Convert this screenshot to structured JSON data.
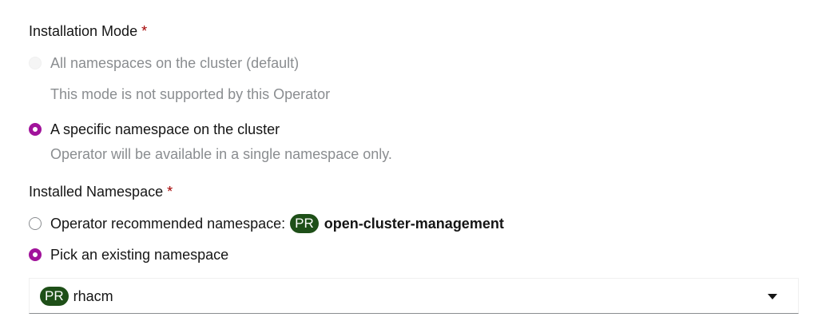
{
  "installation_mode": {
    "label": "Installation Mode",
    "required_marker": "*",
    "options": [
      {
        "label": "All namespaces on the cluster (default)",
        "helper": "This mode is not supported by this Operator",
        "checked": false,
        "disabled": true
      },
      {
        "label": "A specific namespace on the cluster",
        "helper": "Operator will be available in a single namespace only.",
        "checked": true,
        "disabled": false
      }
    ]
  },
  "installed_namespace": {
    "label": "Installed Namespace",
    "required_marker": "*",
    "options": [
      {
        "label": "Operator recommended namespace:",
        "badge": "PR",
        "namespace": "open-cluster-management",
        "checked": false
      },
      {
        "label": "Pick an existing namespace",
        "checked": true
      }
    ],
    "select": {
      "badge": "PR",
      "value": "rhacm"
    }
  },
  "colors": {
    "accent": "#a1139b",
    "badge_bg": "#1e4f18",
    "required": "#a30000",
    "muted_text": "#8a8d90"
  },
  "icons": {
    "dropdown": "caret-down-icon"
  }
}
